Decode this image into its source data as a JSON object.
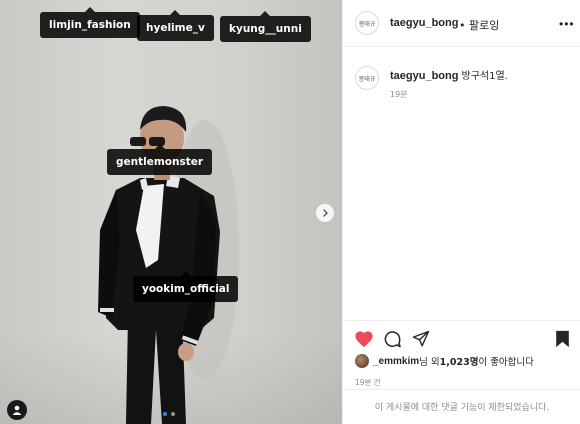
{
  "photo": {
    "tags": [
      {
        "id": "limjin",
        "label": "limjin_fashion"
      },
      {
        "id": "hyelime",
        "label": "hyelime_v"
      },
      {
        "id": "kyung",
        "label": "kyung__unni"
      },
      {
        "id": "gentlemonster",
        "label": "gentlemonster"
      },
      {
        "id": "yookim",
        "label": "yookim_official"
      }
    ],
    "carousel_count": 2,
    "carousel_active": 1
  },
  "header": {
    "avatar_text": "봉태규",
    "username": "taegyu_bong",
    "follow_label": "• 팔로잉",
    "more_label": "•••"
  },
  "caption": {
    "avatar_text": "봉태규",
    "username": "taegyu_bong",
    "text": "방구석1열.",
    "time": "19분"
  },
  "likes": {
    "liker": "_emmkim",
    "middle": "님 외 ",
    "count": "1,023명",
    "suffix": "이 좋아합니다"
  },
  "post_time": "19분 전",
  "comments_disabled": "이 게시물에 대한 댓글 기능이 제한되었습니다.",
  "colors": {
    "heart": "#ed4956",
    "carousel_active_dot": "#2f7ff5",
    "tag_bg": "#000000"
  },
  "icons": [
    "chevron-right-icon",
    "user-tag-icon",
    "heart-icon",
    "comment-icon",
    "share-icon",
    "bookmark-icon",
    "more-icon"
  ]
}
